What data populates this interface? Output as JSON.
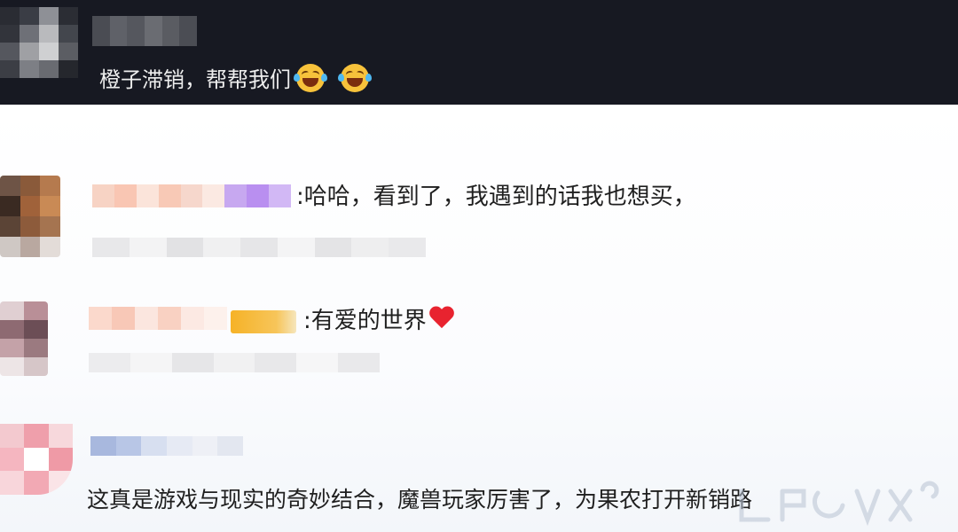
{
  "post": {
    "text": "橙子滞销，帮帮我们",
    "emojis": [
      "rolling-on-floor-laughing-emoji",
      "rolling-on-floor-laughing-emoji"
    ]
  },
  "comments": [
    {
      "text": ":哈哈，看到了，我遇到的话我也想买，",
      "username_blurred": true,
      "subline_blurred": true
    },
    {
      "text": ":有爱的世界",
      "emoji": "red-heart-icon",
      "username_blurred": true,
      "badge_blurred": true,
      "subline_blurred": true
    },
    {
      "text": "这真是游戏与现实的奇妙结合，魔兽玩家厉害了，为果农打开新销路",
      "username_blurred": true
    }
  ],
  "colors": {
    "post_bar_bg": "#171922",
    "post_text": "#eeeeee",
    "comment_text": "#1f1f1f",
    "heart": "#e8232f",
    "badge": "#f6b227"
  }
}
